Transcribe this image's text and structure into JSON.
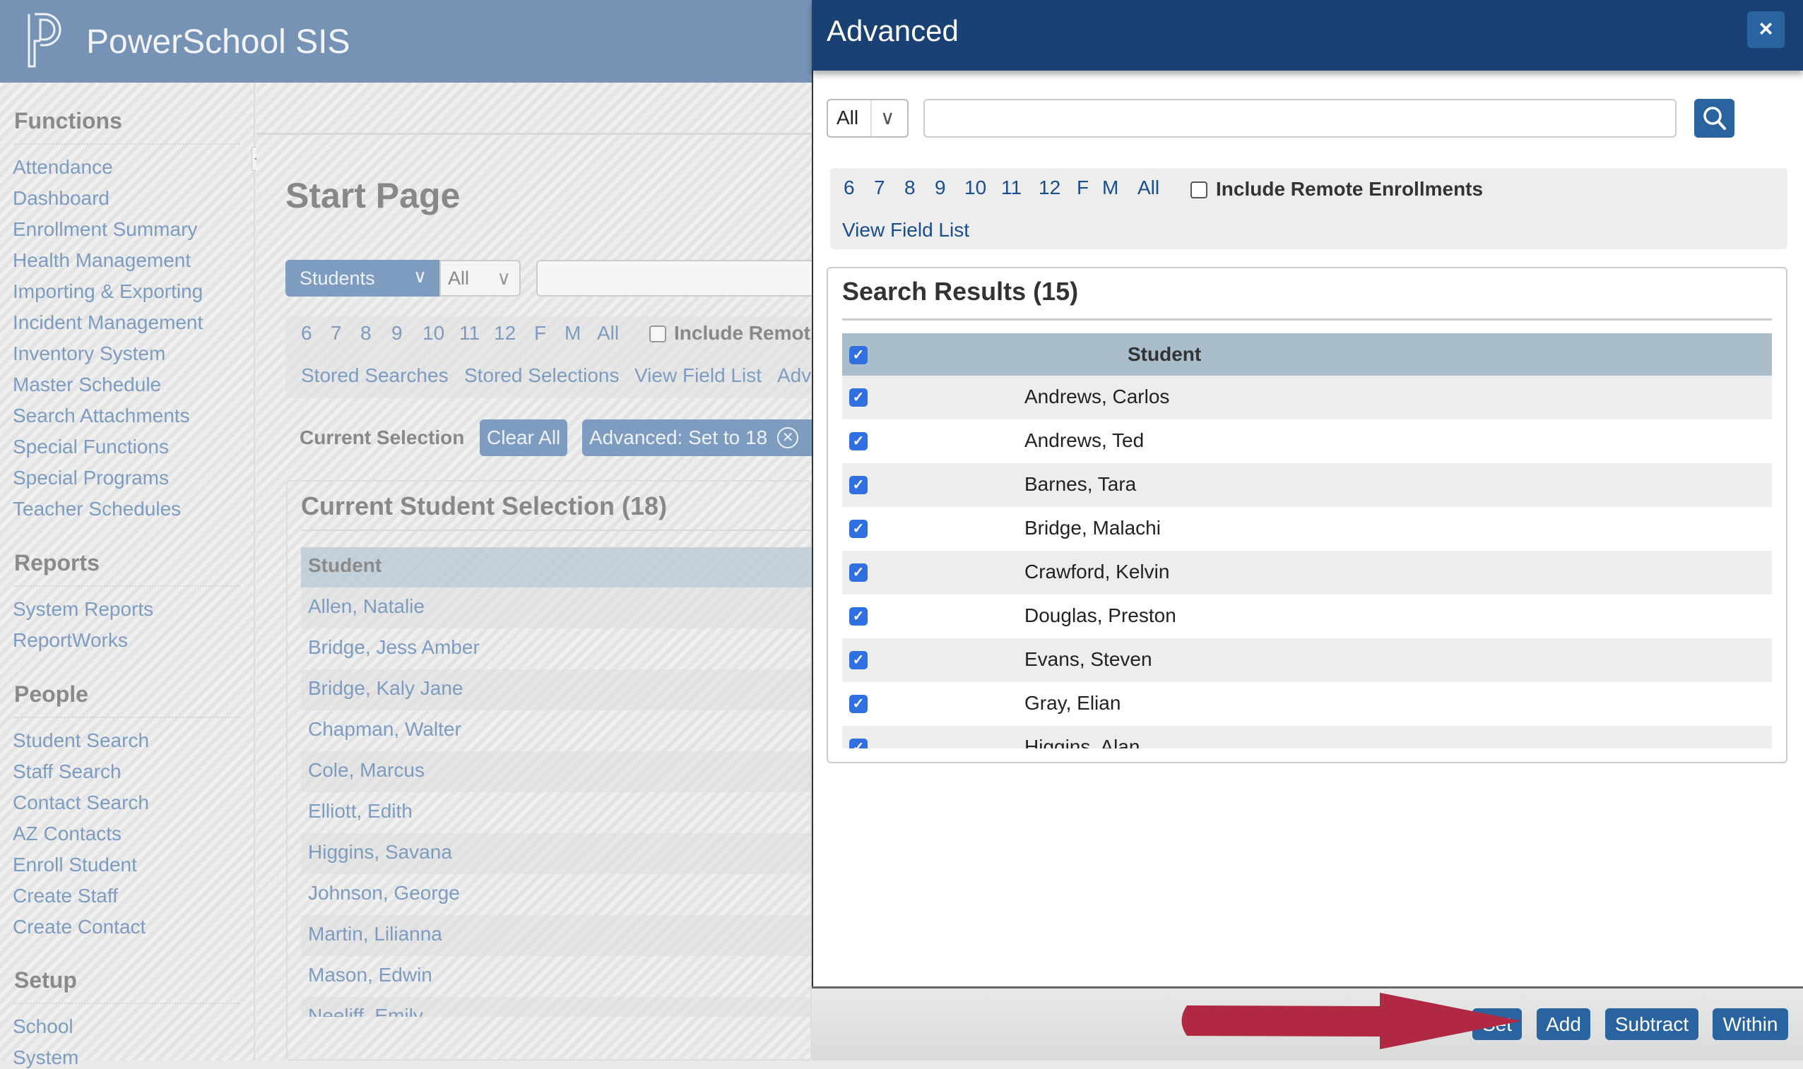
{
  "app": {
    "title": "PowerSchool SIS"
  },
  "sidebar": {
    "sections": [
      {
        "heading": "Functions",
        "items": [
          "Attendance",
          "Dashboard",
          "Enrollment Summary",
          "Health Management",
          "Importing & Exporting",
          "Incident Management",
          "Inventory System",
          "Master Schedule",
          "Search Attachments",
          "Special Functions",
          "Special Programs",
          "Teacher Schedules"
        ]
      },
      {
        "heading": "Reports",
        "items": [
          "System Reports",
          "ReportWorks"
        ]
      },
      {
        "heading": "People",
        "items": [
          "Student Search",
          "Staff Search",
          "Contact Search",
          "AZ Contacts",
          "Enroll Student",
          "Create Staff",
          "Create Contact"
        ]
      },
      {
        "heading": "Setup",
        "items": [
          "School",
          "System"
        ]
      }
    ]
  },
  "main": {
    "title": "Start Page",
    "search_type": "Students",
    "grade_select": "All",
    "grades": [
      "6",
      "7",
      "8",
      "9",
      "10",
      "11",
      "12",
      "F",
      "M",
      "All"
    ],
    "include_remote": "Include Remot",
    "links": [
      "Stored Searches",
      "Stored Selections",
      "View Field List",
      "Adv"
    ],
    "current_selection_label": "Current Selection",
    "clear_all": "Clear All",
    "chip": "Advanced: Set to 18",
    "panel_title": "Current Student Selection (18)",
    "column": "Student",
    "students": [
      "Allen, Natalie",
      "Bridge, Jess Amber",
      "Bridge, Kaly Jane",
      "Chapman, Walter",
      "Cole, Marcus",
      "Elliott, Edith",
      "Higgins, Savana",
      "Johnson, George",
      "Martin, Lilianna",
      "Mason, Edwin",
      "Neeliff, Emily"
    ]
  },
  "modal": {
    "title": "Advanced",
    "close": "×",
    "select_value": "All",
    "search_value": "",
    "grades": [
      "6",
      "7",
      "8",
      "9",
      "10",
      "11",
      "12",
      "F",
      "M",
      "All"
    ],
    "include_remote": "Include Remote Enrollments",
    "view_field_list": "View Field List",
    "results_title": "Search Results (15)",
    "column": "Student",
    "results": [
      "Andrews, Carlos",
      "Andrews, Ted",
      "Barnes, Tara",
      "Bridge, Malachi",
      "Crawford, Kelvin",
      "Douglas, Preston",
      "Evans, Steven",
      "Gray, Elian",
      "Higgins, Alan"
    ],
    "buttons": {
      "set": "Set",
      "add": "Add",
      "subtract": "Subtract",
      "within": "Within"
    },
    "accent": "#2a64a0",
    "header_color": "#1a4173",
    "annotation_arrow_color": "#b02842"
  }
}
